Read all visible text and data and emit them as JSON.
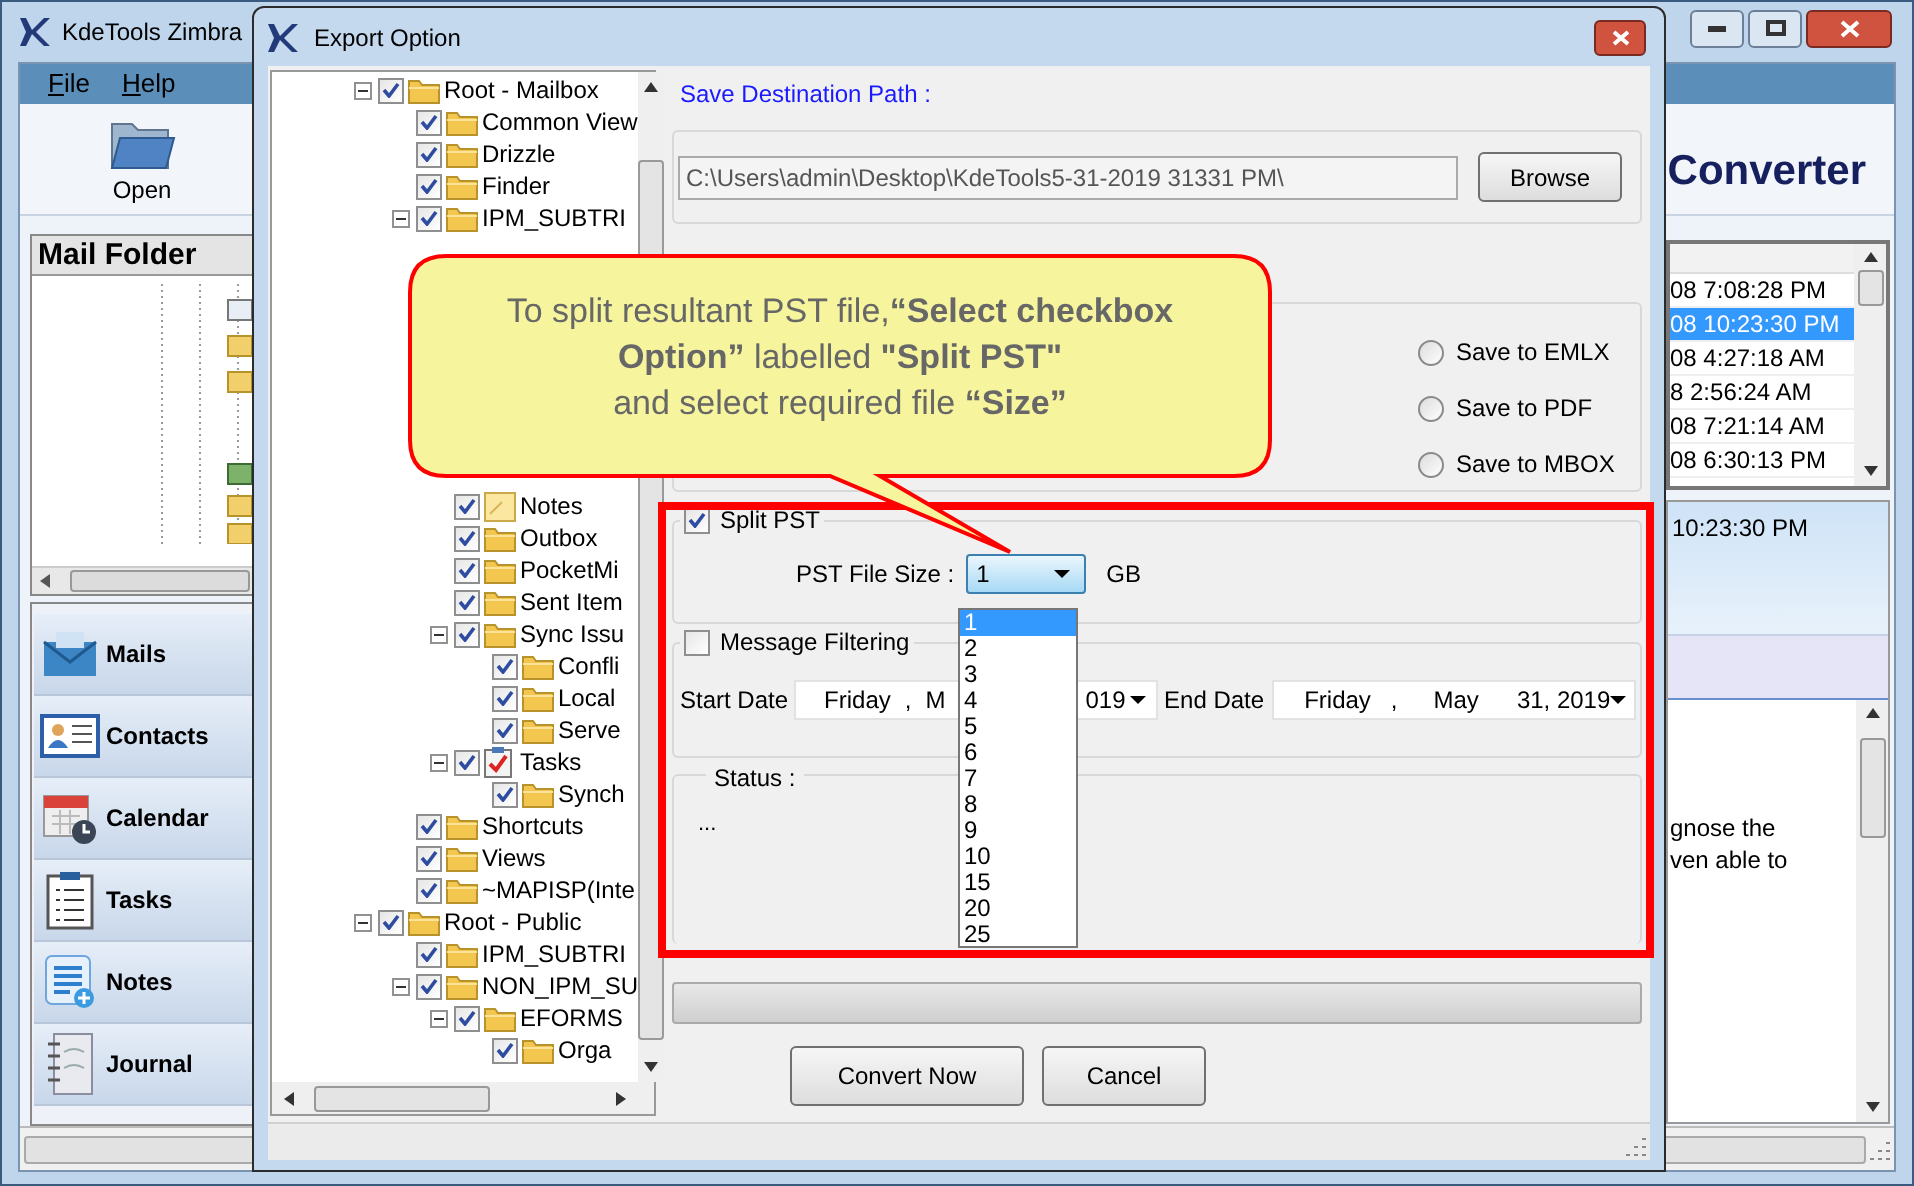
{
  "main_window": {
    "title": "KdeTools Zimbra",
    "menu": [
      {
        "label": "File"
      },
      {
        "label": "Help"
      }
    ],
    "toolbar": [
      {
        "label": "Open"
      }
    ],
    "banner": "Converter",
    "mail_folder": {
      "title": "Mail Folder"
    },
    "nav": [
      {
        "label": "Mails",
        "kind": "mail"
      },
      {
        "label": "Contacts",
        "kind": "contacts"
      },
      {
        "label": "Calendar",
        "kind": "calendar"
      },
      {
        "label": "Tasks",
        "kind": "tasks"
      },
      {
        "label": "Notes",
        "kind": "notes"
      },
      {
        "label": "Journal",
        "kind": "journal"
      }
    ],
    "messages": [
      {
        "date": "08 7:08:28 PM",
        "selected": false
      },
      {
        "date": "08 10:23:30 PM",
        "selected": true
      },
      {
        "date": "08 4:27:18 AM",
        "selected": false
      },
      {
        "date": "8 2:56:24 AM",
        "selected": false
      },
      {
        "date": "08 7:21:14 AM",
        "selected": false
      },
      {
        "date": "08 6:30:13 PM",
        "selected": false
      }
    ],
    "preview": {
      "date": "10:23:30 PM",
      "body": [
        "gnose the",
        "ven able to"
      ]
    },
    "status_progress": {
      "level": 0
    }
  },
  "dialog": {
    "title": "Export Option",
    "tree": [
      {
        "label": "Root - Mailbox",
        "kind": "folder",
        "checked": true,
        "expanded": true,
        "children": [
          {
            "label": "Common View",
            "kind": "folder",
            "checked": true
          },
          {
            "label": "Drizzle",
            "kind": "folder",
            "checked": true
          },
          {
            "label": "Finder",
            "kind": "folder",
            "checked": true
          },
          {
            "label": "IPM_SUBTRI",
            "kind": "folder",
            "checked": true,
            "expanded": true,
            "children": [
              {
                "label": "Notes",
                "kind": "note",
                "checked": true
              },
              {
                "label": "Outbox",
                "kind": "folder",
                "checked": true
              },
              {
                "label": "PocketMi",
                "kind": "folder",
                "checked": true
              },
              {
                "label": "Sent Item",
                "kind": "folder",
                "checked": true
              },
              {
                "label": "Sync Issu",
                "kind": "folder",
                "checked": true,
                "expanded": true,
                "children": [
                  {
                    "label": "Confli",
                    "kind": "folder",
                    "checked": true
                  },
                  {
                    "label": "Local",
                    "kind": "folder",
                    "checked": true
                  },
                  {
                    "label": "Serve",
                    "kind": "folder",
                    "checked": true
                  }
                ]
              },
              {
                "label": "Tasks",
                "kind": "tasks",
                "checked": true,
                "expanded": true,
                "children": [
                  {
                    "label": "Synch",
                    "kind": "folder",
                    "checked": true
                  }
                ]
              }
            ]
          },
          {
            "label": "Shortcuts",
            "kind": "folder",
            "checked": true
          },
          {
            "label": "Views",
            "kind": "folder",
            "checked": true
          },
          {
            "label": "~MAPISP(Inte",
            "kind": "folder",
            "checked": true
          }
        ]
      },
      {
        "label": "Root - Public",
        "kind": "folder",
        "checked": true,
        "expanded": true,
        "children": [
          {
            "label": "IPM_SUBTRI",
            "kind": "folder",
            "checked": true
          },
          {
            "label": "NON_IPM_SU",
            "kind": "folder",
            "checked": true,
            "expanded": true,
            "children": [
              {
                "label": "EFORMS",
                "kind": "folder",
                "checked": true,
                "expanded": true,
                "children": [
                  {
                    "label": "Orga",
                    "kind": "folder",
                    "checked": true
                  }
                ]
              }
            ]
          }
        ]
      }
    ],
    "save_path": {
      "label": "Save Destination Path :",
      "value": "C:\\Users\\admin\\Desktop\\KdeTools5-31-2019 31331 PM\\",
      "button": "Browse"
    },
    "formats": [
      {
        "label": "Save to EMLX",
        "selected": false
      },
      {
        "label": "Save to PDF",
        "selected": false
      },
      {
        "label": "Save to MBOX",
        "selected": false
      }
    ],
    "split": {
      "label": "Split PST",
      "checked": true,
      "size_label": "PST File Size :",
      "size_value": "1",
      "unit": "GB",
      "options": [
        {
          "label": "1",
          "selected": true
        },
        {
          "label": "2",
          "selected": false
        },
        {
          "label": "3",
          "selected": false
        },
        {
          "label": "4",
          "selected": false
        },
        {
          "label": "5",
          "selected": false
        },
        {
          "label": "6",
          "selected": false
        },
        {
          "label": "7",
          "selected": false
        },
        {
          "label": "8",
          "selected": false
        },
        {
          "label": "9",
          "selected": false
        },
        {
          "label": "10",
          "selected": false
        },
        {
          "label": "15",
          "selected": false
        },
        {
          "label": "20",
          "selected": false
        },
        {
          "label": "25",
          "selected": false
        }
      ]
    },
    "filter": {
      "label": "Message Filtering",
      "checked": false,
      "start_label": "Start Date",
      "start_parts": [
        "Friday",
        ",",
        "M",
        "019"
      ],
      "end_label": "End Date",
      "end_parts": [
        "Friday",
        ",",
        "May",
        "31, 2019"
      ]
    },
    "status": {
      "label": "Status :",
      "text": "..."
    },
    "progress": {
      "level": 0
    },
    "buttons": [
      "Convert Now",
      "Cancel"
    ]
  },
  "callout": {
    "lines": [
      "To split resultant PST file,**“Select checkbox**",
      "**Option”** labelled  **\"Split PST\"**",
      "and select required file **“Size”**"
    ]
  }
}
